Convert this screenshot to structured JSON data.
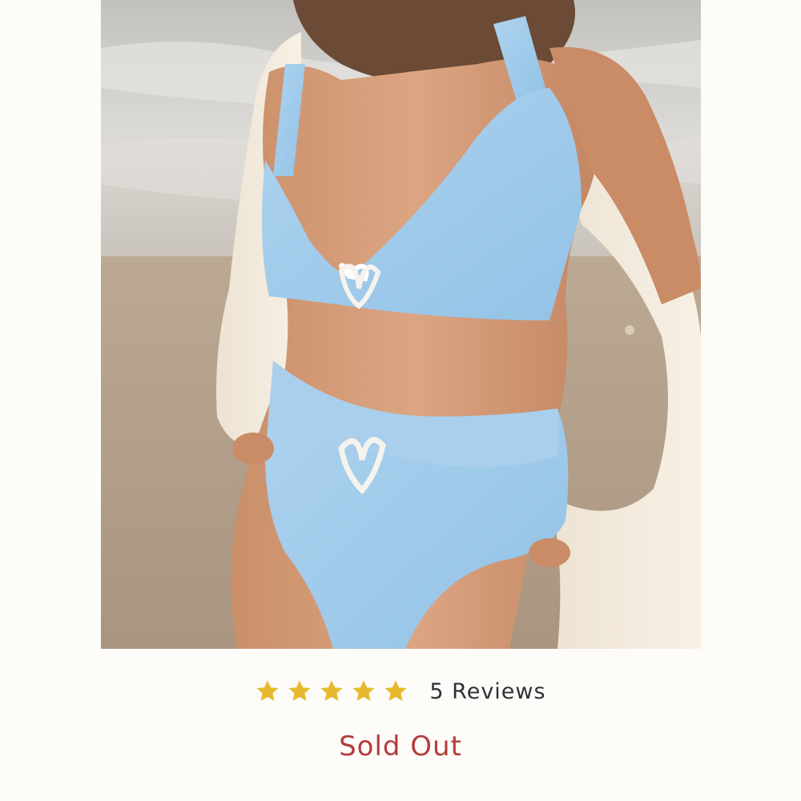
{
  "product": {
    "image_alt": "Light blue two-piece swimsuit with heart ring details",
    "rating": {
      "stars_filled": 5,
      "stars_total": 5,
      "star_color": "#e8b92f",
      "reviews_label": "5 Reviews"
    },
    "status": {
      "label": "Sold Out",
      "color": "#b43c3c"
    }
  }
}
